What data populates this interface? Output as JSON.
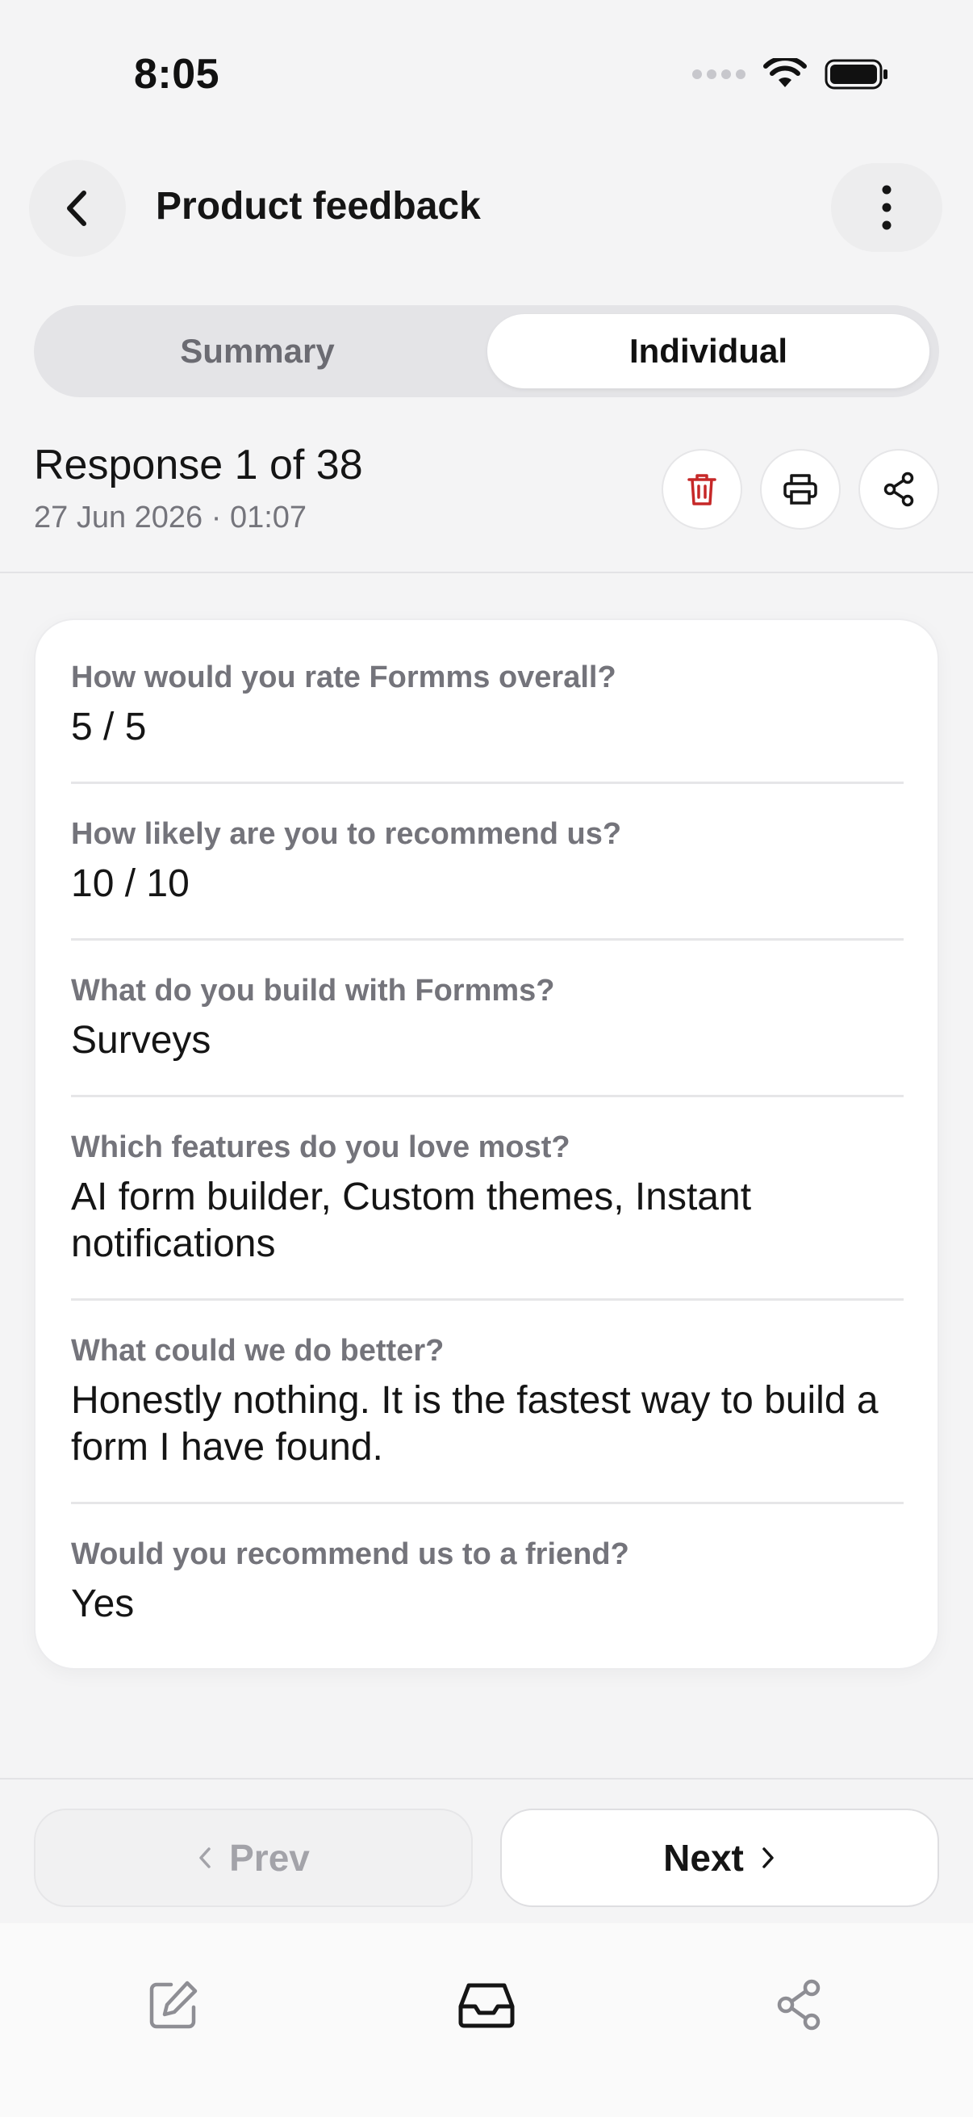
{
  "status_bar": {
    "time": "8:05"
  },
  "header": {
    "title": "Product feedback"
  },
  "tabs": [
    {
      "label": "Summary",
      "active": false
    },
    {
      "label": "Individual",
      "active": true
    }
  ],
  "response": {
    "title": "Response 1 of 38",
    "date": "27 Jun 2026 · 01:07"
  },
  "actions": {
    "delete_icon": "trash-icon",
    "print_icon": "printer-icon",
    "share_icon": "share-icon"
  },
  "answers": [
    {
      "question": "How would you rate Formms overall?",
      "answer": "5 / 5"
    },
    {
      "question": "How likely are you to recommend us?",
      "answer": "10 / 10"
    },
    {
      "question": "What do you build with Formms?",
      "answer": "Surveys"
    },
    {
      "question": "Which features do you love most?",
      "answer": "AI form builder, Custom themes, Instant notifications"
    },
    {
      "question": "What could we do better?",
      "answer": "Honestly nothing. It is the fastest way to build a form I have found."
    },
    {
      "question": "Would you recommend us to a friend?",
      "answer": "Yes"
    }
  ],
  "pager": {
    "prev_label": "Prev",
    "next_label": "Next"
  },
  "tabbar": {
    "icons": [
      "edit-icon",
      "inbox-icon",
      "share-icon"
    ]
  },
  "colors": {
    "delete_red": "#c62828",
    "muted": "#74747b",
    "background": "#f4f4f5"
  }
}
